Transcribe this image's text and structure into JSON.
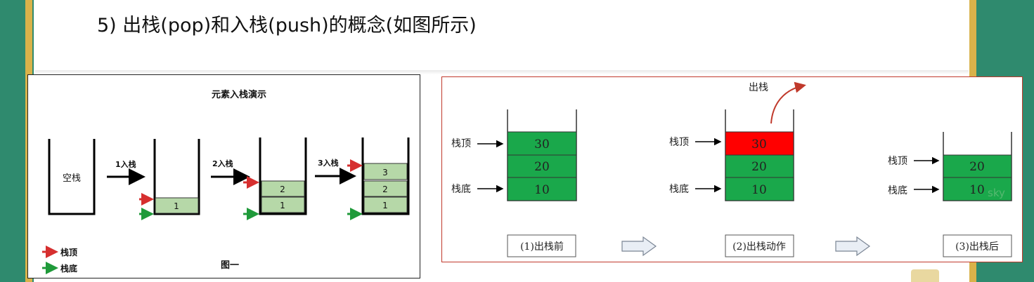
{
  "title": "5)   出栈(pop)和入栈(push)的概念(如图所示)",
  "figure1": {
    "heading": "元素入栈演示",
    "empty_stack_label": "空栈",
    "steps": [
      {
        "label": "1入栈",
        "items": [
          "1"
        ]
      },
      {
        "label": "2入栈",
        "items": [
          "1",
          "2"
        ]
      },
      {
        "label": "3入栈",
        "items": [
          "1",
          "2",
          "3"
        ]
      }
    ],
    "legend": [
      {
        "label": "栈顶",
        "color": "#d62f2f"
      },
      {
        "label": "栈底",
        "color": "#1f9a3a"
      }
    ],
    "caption": "图一",
    "box_color": "#b6d8a8"
  },
  "figure2": {
    "pop_label": "出栈",
    "top_label": "栈顶",
    "bottom_label": "栈底",
    "stacks": [
      {
        "caption": "(1)出栈前",
        "items": [
          "30",
          "20",
          "10"
        ]
      },
      {
        "caption": "(2)出栈动作",
        "items": [
          "30",
          "20",
          "10"
        ],
        "popping": "30"
      },
      {
        "caption": "(3)出栈后",
        "items": [
          "20",
          "10"
        ]
      }
    ],
    "watermark": "sky",
    "green": "#1aa84b",
    "red": "#ff0000"
  }
}
